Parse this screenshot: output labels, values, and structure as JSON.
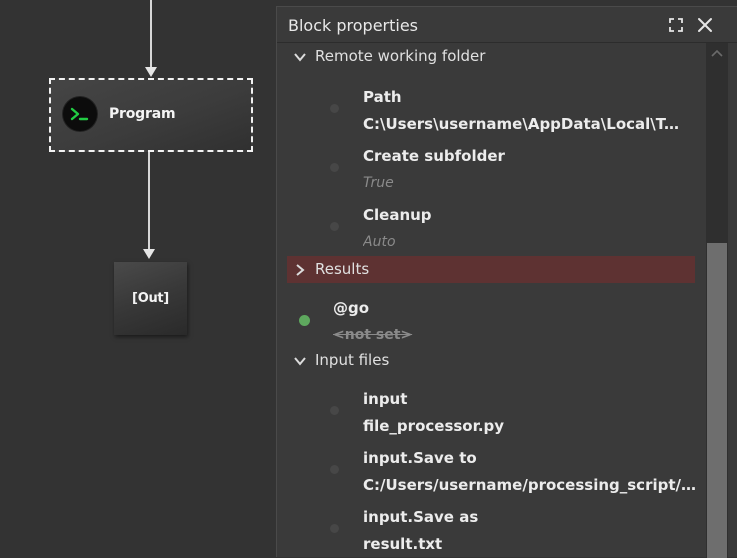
{
  "canvas": {
    "program_block": {
      "label": "Program",
      "icon": "terminal-icon",
      "icon_color": "#22cc44"
    },
    "out_block": {
      "label": "[Out]"
    }
  },
  "panel": {
    "title": "Block properties",
    "maximize_icon": "maximize-icon",
    "close_icon": "close-icon",
    "groups": {
      "remote_working_folder": {
        "label": "Remote working folder",
        "expanded": true,
        "props": [
          {
            "name": "Path",
            "value": "C:\\Users\\username\\AppData\\Local\\Temp"
          },
          {
            "name": "Create subfolder",
            "value": "True"
          },
          {
            "name": "Cleanup",
            "value": "Auto"
          }
        ]
      },
      "results": {
        "label": "Results",
        "expanded": false,
        "highlight_color": "#5e3232",
        "props": [
          {
            "name": "@go",
            "value": "<not set>",
            "status_color": "#5ea85e"
          }
        ]
      },
      "input_files": {
        "label": "Input files",
        "expanded": true,
        "props": [
          {
            "name": "input",
            "value": "file_processor.py"
          },
          {
            "name": "input.Save to",
            "value": "C:/Users/username/processing_script/re..."
          },
          {
            "name": "input.Save as",
            "value": "result.txt"
          }
        ]
      }
    }
  }
}
